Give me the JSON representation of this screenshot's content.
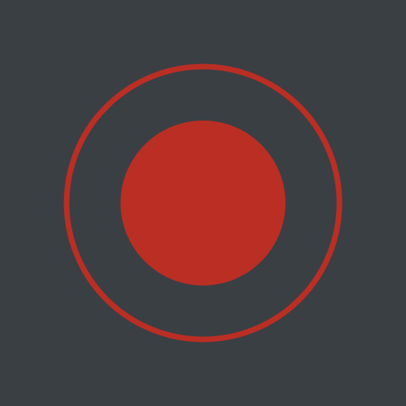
{
  "app": {
    "background_color": "#3a3f44"
  },
  "record_control": {
    "icon": "record-icon",
    "ring_color": "#bb2e23",
    "dot_color": "#bb2e23"
  }
}
